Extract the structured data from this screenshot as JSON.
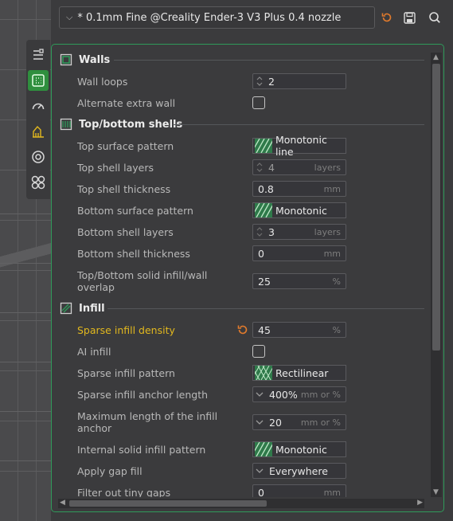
{
  "preset": {
    "name": "* 0.1mm Fine @Creality Ender-3 V3 Plus 0.4 nozzle"
  },
  "toolbar_icons": [
    "reset-icon",
    "save-icon",
    "search-icon"
  ],
  "tabs": [
    {
      "name": "quality-tab",
      "icon": "layers-icon",
      "active": false
    },
    {
      "name": "strength-tab",
      "icon": "strength-icon",
      "active": true
    },
    {
      "name": "speed-tab",
      "icon": "speedometer-icon",
      "active": false
    },
    {
      "name": "support-tab",
      "icon": "support-icon",
      "active": false
    },
    {
      "name": "multimaterial-tab",
      "icon": "nozzle-icon",
      "active": false
    },
    {
      "name": "others-tab",
      "icon": "others-icon",
      "active": false
    }
  ],
  "colors": {
    "accent": "#2f9a5a",
    "highlight": "#e2b81e",
    "reset": "#e07a2c"
  },
  "sections": {
    "walls": {
      "title": "Walls",
      "wall_loops": {
        "label": "Wall loops",
        "value": "2"
      },
      "alternate_extra_wall": {
        "label": "Alternate extra wall",
        "checked": false
      }
    },
    "top_bottom": {
      "title": "Top/bottom shells",
      "top_surface_pattern": {
        "label": "Top surface pattern",
        "value": "Monotonic line"
      },
      "top_shell_layers": {
        "label": "Top shell layers",
        "value": "4",
        "unit": "layers"
      },
      "top_shell_thickness": {
        "label": "Top shell thickness",
        "value": "0.8",
        "unit": "mm"
      },
      "bottom_surface_pattern": {
        "label": "Bottom surface pattern",
        "value": "Monotonic"
      },
      "bottom_shell_layers": {
        "label": "Bottom shell layers",
        "value": "3",
        "unit": "layers"
      },
      "bottom_shell_thickness": {
        "label": "Bottom shell thickness",
        "value": "0",
        "unit": "mm"
      },
      "solid_infill_overlap": {
        "label_line1": "Top/Bottom solid infill/wall",
        "label_line2": "overlap",
        "value": "25",
        "unit": "%"
      }
    },
    "infill": {
      "title": "Infill",
      "sparse_infill_density": {
        "label": "Sparse infill density",
        "value": "45",
        "unit": "%"
      },
      "ai_infill": {
        "label": "AI infill",
        "checked": false
      },
      "sparse_infill_pattern": {
        "label": "Sparse infill pattern",
        "value": "Rectilinear"
      },
      "sparse_infill_anchor_length": {
        "label": "Sparse infill anchor length",
        "value": "400%",
        "unit": "mm or %"
      },
      "max_infill_anchor": {
        "label_line1": "Maximum length of the infill",
        "label_line2": "anchor",
        "value": "20",
        "unit": "mm or %"
      },
      "internal_solid_infill_pattern": {
        "label": "Internal solid infill pattern",
        "value": "Monotonic"
      },
      "apply_gap_fill": {
        "label": "Apply gap fill",
        "value": "Everywhere"
      },
      "filter_tiny_gaps": {
        "label": "Filter out tiny gaps",
        "value": "0",
        "unit": "mm"
      }
    }
  }
}
